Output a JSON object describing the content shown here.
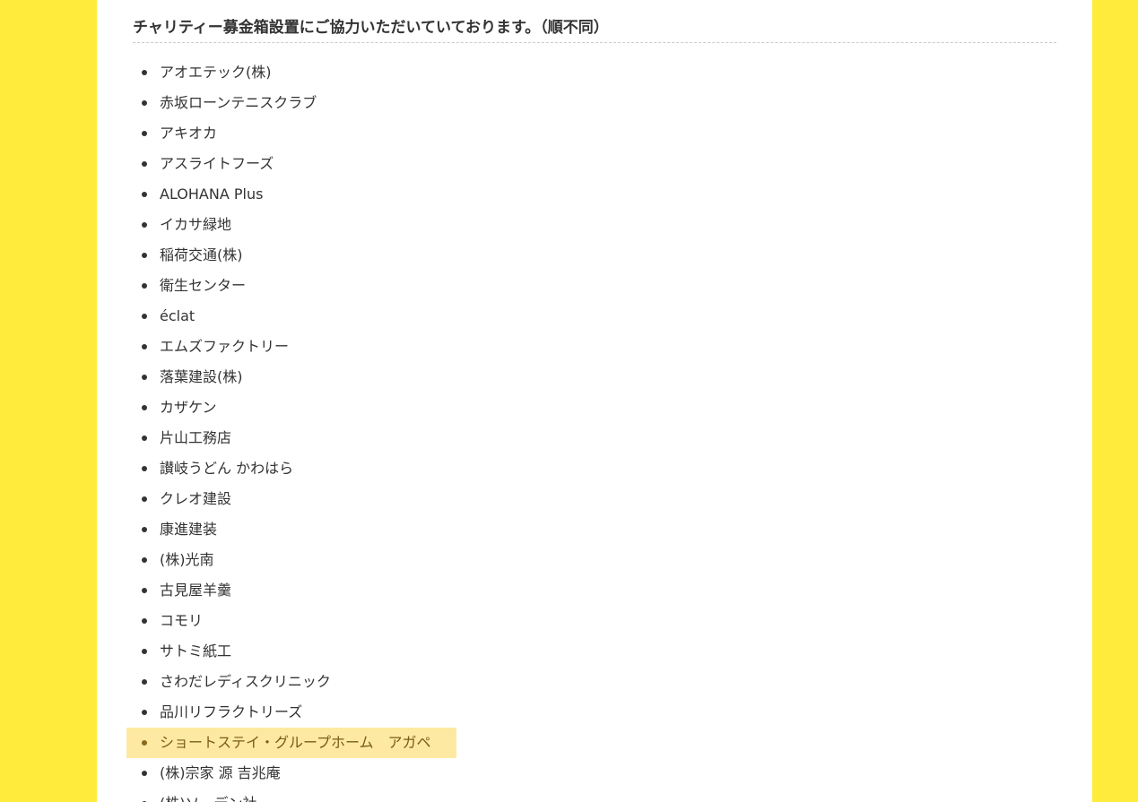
{
  "page": {
    "heading": "チャリティー募金箱設置にご協力いただいていております。（順不同）"
  },
  "sponsors": [
    "アオエテック(株)",
    "赤坂ローンテニスクラブ",
    "アキオカ",
    "アスライトフーズ",
    "ALOHANA Plus",
    "イカサ緑地",
    "稲荷交通(株)",
    "衛生センター",
    "éclat",
    "エムズファクトリー",
    "落葉建設(株)",
    "カザケン",
    "片山工務店",
    "讃岐うどん かわはら",
    "クレオ建設",
    "康進建装",
    "(株)光南",
    "古見屋羊羹",
    "コモリ",
    "サトミ紙工",
    "さわだレディスクリニック",
    "品川リフラクトリーズ",
    "ショートステイ・グループホーム　アガペ",
    "(株)宗家 源 吉兆庵",
    "(株)ソーデン社"
  ],
  "highlighted_index": 22,
  "colors": {
    "page_background": "#ffeb3b",
    "panel_background": "#ffffff",
    "highlight_background": "#fde9a2",
    "text": "#333333"
  }
}
